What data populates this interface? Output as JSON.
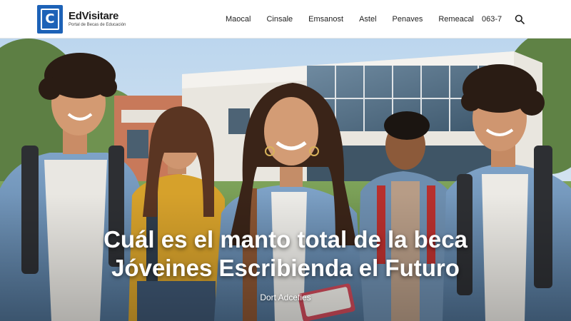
{
  "header": {
    "brand_name": "EdVisitare",
    "brand_tagline": "Portal de Becas de Educación",
    "logo_letter": "C",
    "nav": [
      "Maocal",
      "Cinsale",
      "Emsanost",
      "Astel",
      "Penaves",
      "Remeacal"
    ],
    "phone": "063-7",
    "search_icon": "search-icon"
  },
  "hero": {
    "headline_line1": "Cuál es el manto total de la beca",
    "headline_line2": "Jóveines Escribienda el Futuro",
    "byline": "Dort Adcefies"
  },
  "colors": {
    "brand": "#1d62b7",
    "header_bg": "#ffffff",
    "headline": "#ffffff"
  }
}
